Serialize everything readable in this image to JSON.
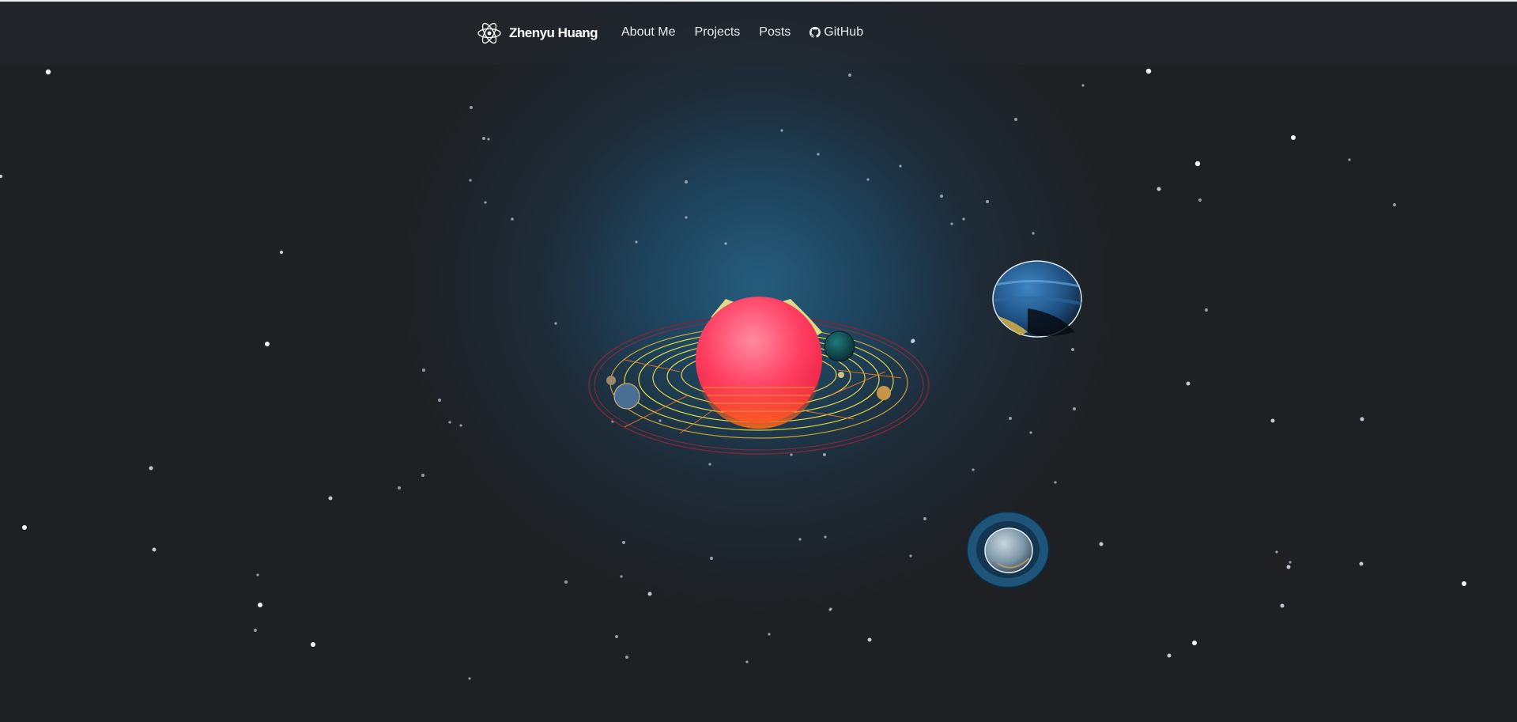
{
  "navbar": {
    "brand": {
      "name": "Zhenyu Huang",
      "icon": "atom-icon"
    },
    "links": [
      {
        "label": "About Me"
      },
      {
        "label": "Projects"
      },
      {
        "label": "Posts"
      },
      {
        "label": "GitHub",
        "icon": "github-icon"
      }
    ]
  },
  "scene": {
    "objects": [
      "sun-with-orbits",
      "blue-gas-planet",
      "ringed-planet",
      "starfield"
    ],
    "colors": {
      "background": "#1f2023",
      "glow": "#266082",
      "sun": "#ff4d6d",
      "orbit": "#e8e84a"
    }
  }
}
